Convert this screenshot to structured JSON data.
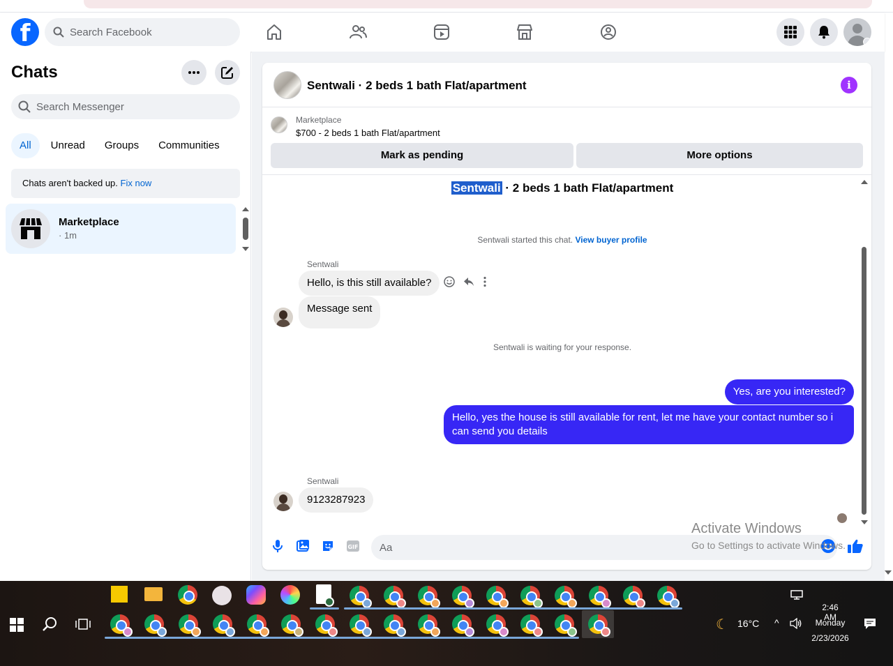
{
  "header": {
    "search_placeholder": "Search Facebook"
  },
  "sidebar": {
    "title": "Chats",
    "search_placeholder": "Search Messenger",
    "filters": [
      "All",
      "Unread",
      "Groups",
      "Communities"
    ],
    "active_filter": "All",
    "backup_text": "Chats aren't backed up.",
    "backup_link": "Fix now",
    "chats": [
      {
        "name": "Marketplace",
        "time": "· 1m"
      }
    ]
  },
  "conversation": {
    "title": "Sentwali · 2 beds 1 bath Flat/apartment",
    "listing_source": "Marketplace",
    "listing_price": "$700 - 2 beds 1 bath Flat/apartment",
    "mark_pending_label": "Mark as pending",
    "more_options_label": "More options",
    "thread_title_highlight": "Sentwali",
    "thread_title_rest": " · 2 beds 1 bath Flat/apartment",
    "started_text": "Sentwali started this chat.",
    "view_profile_link": "View buyer profile",
    "waiting_text": "Sentwali is waiting for your response.",
    "messages": [
      {
        "sender": "Sentwali",
        "text": "Hello, is this still available?",
        "direction": "in"
      },
      {
        "sender": "",
        "text": "Message sent",
        "direction": "in"
      },
      {
        "sender": "",
        "text": "Yes, are you interested?",
        "direction": "out"
      },
      {
        "sender": "",
        "text": "Hello, yes the house is still available for rent, let me have your contact number so i can send you details",
        "direction": "out"
      },
      {
        "sender": "Sentwali",
        "text": "9123287923",
        "direction": "in"
      }
    ],
    "composer_placeholder": "Aa"
  },
  "watermark": {
    "line1": "Activate Windows",
    "line2": "Go to Settings to activate Windows."
  },
  "taskbar": {
    "weather": "16°C",
    "time": "2:46 AM",
    "day": "Monday",
    "date": "2/23/2026"
  },
  "colors": {
    "accent": "#0866ff",
    "outgoing_bubble": "#3727f5",
    "info_icon": "#a033ff",
    "active_filter_bg": "#ebf5ff"
  }
}
